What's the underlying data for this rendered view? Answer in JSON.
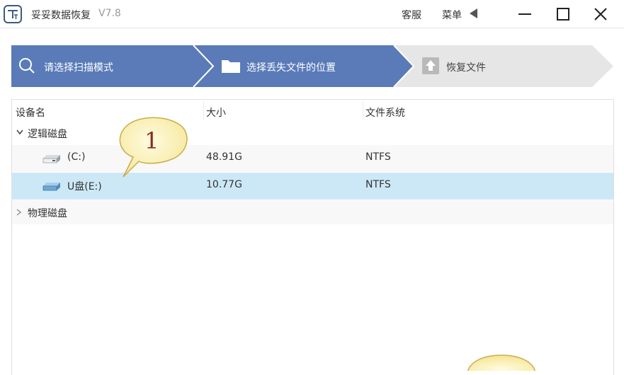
{
  "app": {
    "title": "妥妥数据恢复",
    "version": "V7.8",
    "service_label": "客服",
    "menu_label": "菜单"
  },
  "steps": [
    {
      "label": "请选择扫描模式",
      "icon": "search-icon",
      "state": "done"
    },
    {
      "label": "选择丢失文件的位置",
      "icon": "folder-icon",
      "state": "active"
    },
    {
      "label": "恢复文件",
      "icon": "upload-icon",
      "state": "pending"
    }
  ],
  "colors": {
    "step_active": "#5a7bb8",
    "step_pending": "#e6e6e6",
    "selected_row": "#cce8f6",
    "callout_fill": "#fdf4c0"
  },
  "table": {
    "headers": [
      "设备名",
      "大小",
      "文件系统"
    ],
    "groups": [
      {
        "name": "逻辑磁盘",
        "expanded": true,
        "items": [
          {
            "name": "(C:)",
            "size": "48.91G",
            "fs": "NTFS",
            "icon": "hard-drive-icon",
            "selected": false
          },
          {
            "name": "U盘(E:)",
            "size": "10.77G",
            "fs": "NTFS",
            "icon": "usb-drive-icon",
            "selected": true
          }
        ]
      },
      {
        "name": "物理磁盘",
        "expanded": false,
        "items": []
      }
    ]
  },
  "callouts": [
    {
      "number": "1"
    }
  ]
}
